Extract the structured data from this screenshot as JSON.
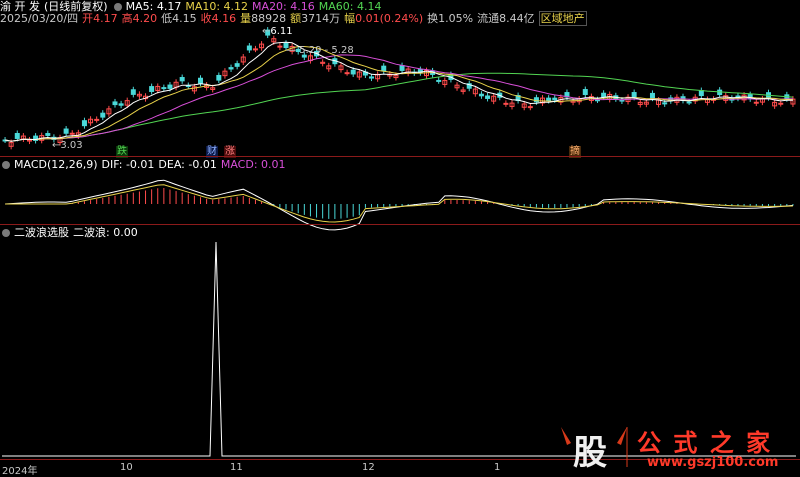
{
  "header": {
    "stock_name": "渝 开 发",
    "mode": "(日线前复权)",
    "ma5_label": "MA5:",
    "ma5": "4.17",
    "ma10_label": "MA10:",
    "ma10": "4.12",
    "ma20_label": "MA20:",
    "ma20": "4.16",
    "ma60_label": "MA60:",
    "ma60": "4.14"
  },
  "quote": {
    "date": "2025/03/20/四",
    "open_label": "开",
    "open": "4.17",
    "high_label": "高",
    "high": "4.20",
    "low_label": "低",
    "low": "4.15",
    "close_label": "收",
    "close": "4.16",
    "vol_label": "量",
    "vol": "88928",
    "amount_label": "额",
    "amount": "3714万",
    "chg_label": "幅",
    "chg": "0.01(0.24%)",
    "turnover_label": "换",
    "turnover": "1.05%",
    "float_label": "流通",
    "float": "8.44亿",
    "sector": "区域地产"
  },
  "price_annotations": {
    "high_mark": "6.11",
    "range_mark": "5.29 - 5.28",
    "low_mark": "3.03"
  },
  "event_tags": [
    "跌",
    "财",
    "涨",
    "摘"
  ],
  "macd": {
    "title": "MACD(12,26,9)",
    "dif_label": "DIF:",
    "dif": "-0.01",
    "dea_label": "DEA:",
    "dea": "-0.01",
    "macd_label": "MACD:",
    "macd": "0.01"
  },
  "indicator": {
    "title": "二波浪选股",
    "label": "二波浪:",
    "value": "0.00"
  },
  "x_axis": [
    "2024年",
    "10",
    "11",
    "12",
    "1"
  ],
  "watermark": {
    "logo_char": "股",
    "title": "公 式 之 家",
    "url": "www.gszj100.com"
  },
  "colors": {
    "up": "#ff4c4c",
    "down": "#4ad8d8",
    "ma5": "#ffffff",
    "ma10": "#e8d24a",
    "ma20": "#d84fd8",
    "ma60": "#52d452",
    "separator": "#8b1a1a"
  }
}
